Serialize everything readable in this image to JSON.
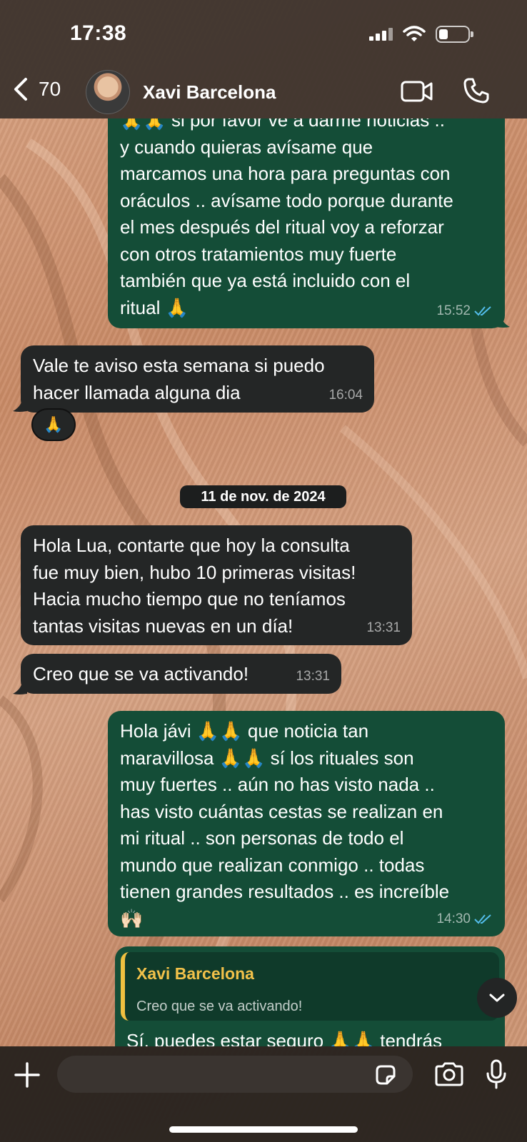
{
  "status_bar": {
    "time": "17:38"
  },
  "header": {
    "back_count": "70",
    "contact_name": "Xavi Barcelona"
  },
  "messages": [
    {
      "dir": "out",
      "lines": [
        "🙏🙏 si por favor ve a darme noticias ..",
        "y cuando quieras avísame que",
        "marcamos una hora para preguntas con",
        "oráculos .. avísame todo porque durante",
        "el mes después del ritual voy a reforzar",
        "con otros tratamientos muy fuerte",
        "también que ya está incluido con el",
        "ritual 🙏"
      ],
      "time": "15:52"
    },
    {
      "dir": "in",
      "lines": [
        "Vale te aviso esta semana si puedo",
        "hacer llamada alguna dia"
      ],
      "time": "16:04",
      "reaction": "🙏"
    },
    {
      "dir": "in",
      "lines": [
        "Hola Lua, contarte que hoy la consulta",
        "fue muy bien, hubo 10 primeras visitas!",
        "Hacia mucho tiempo que no teníamos",
        "tantas visitas nuevas en un día!"
      ],
      "time": "13:31"
    },
    {
      "dir": "in",
      "lines": [
        "Creo que se va activando!"
      ],
      "time": "13:31"
    },
    {
      "dir": "out",
      "lines": [
        "Hola jávi 🙏🙏 que noticia tan",
        "maravillosa 🙏🙏 sí los rituales son",
        "muy fuertes .. aún no has visto nada ..",
        "has visto cuántas cestas se realizan en",
        "mi ritual .. son personas de todo el",
        "mundo que realizan conmigo .. todas",
        "tienen grandes resultados .. es increíble",
        "🙌🏻"
      ],
      "time": "14:30"
    },
    {
      "dir": "out",
      "reply_to": {
        "name": "Xavi Barcelona",
        "text": "Creo que se va activando!"
      },
      "lines": [
        "Sí, puedes estar seguro 🙏🙏 tendrás"
      ]
    }
  ],
  "date_separator": "11 de nov. de 2024",
  "composer": {
    "placeholder": ""
  },
  "colors": {
    "out_bubble": "#144d37",
    "in_bubble": "#242626",
    "read_ticks": "#53bdeb",
    "quote_accent": "#f0c040"
  },
  "icons": [
    "chevron-left-icon",
    "video-camera-icon",
    "phone-icon",
    "plus-icon",
    "sticker-icon",
    "camera-icon",
    "mic-icon",
    "chevron-down-icon",
    "double-check-icon"
  ]
}
